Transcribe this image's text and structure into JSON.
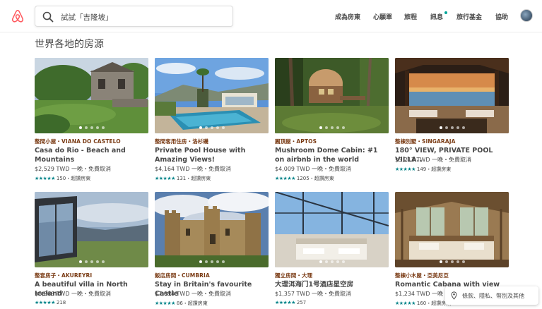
{
  "header": {
    "search_placeholder": "試試「吉隆坡」",
    "nav": [
      "成為房東",
      "心願單",
      "旅程",
      "訊息",
      "旅行基金",
      "協助"
    ]
  },
  "section_title": "世界各地的房源",
  "listings": [
    {
      "kind": "整間小屋・VIANA DO CASTELO",
      "title": "Casa do Rio - Beach and Mountains",
      "price": "$2,529 TWD 一晚・免費取消",
      "stars": "★★★★★",
      "reviews": "150・超讚房東"
    },
    {
      "kind": "整間客用住房・洛杉磯",
      "title": "Private Pool House with Amazing Views!",
      "price": "$4,164 TWD 一晚・免費取消",
      "stars": "★★★★★",
      "reviews": "131・超讚房東"
    },
    {
      "kind": "圓頂屋・APTOS",
      "title": "Mushroom Dome Cabin: #1 on airbnb in the world",
      "price": "$4,009 TWD 一晚・免費取消",
      "stars": "★★★★★",
      "reviews": "1205・超讚房東"
    },
    {
      "kind": "整棟別墅・SINGARAJA",
      "title": "180° VIEW, PRIVATE POOL VILLA..",
      "price": "$5,212 TWD 一晚・免費取消",
      "stars": "★★★★★",
      "reviews": "149・超讚房東"
    },
    {
      "kind": "整套房子・AKUREYRI",
      "title": "A beautiful villa in North Iceland",
      "price": "$8,266 TWD 一晚・免費取消",
      "stars": "★★★★★",
      "reviews": "218"
    },
    {
      "kind": "飯店房間・CUMBRIA",
      "title": "Stay in Britain's favourite Castle",
      "price": "$7,094 TWD 一晚・免費取消",
      "stars": "★★★★★",
      "reviews": "86・超讚房東"
    },
    {
      "kind": "獨立房間・大理",
      "title": "大理洱海门1号酒店星空房",
      "price": "$1,357 TWD 一晚・免費取消",
      "stars": "★★★★★",
      "reviews": "257"
    },
    {
      "kind": "整棟小木屋・亞美尼亞",
      "title": "Romantic Cabana with view",
      "price": "$1,234 TWD 一晚・免費取消",
      "stars": "★★★★★",
      "reviews": "160・超讚房東"
    }
  ],
  "footer_pill": "條款、隱私、幣別及其他",
  "colors": {
    "brand": "#FF5A5F",
    "teal": "#008489",
    "kind": "#7a3b14"
  },
  "icons": [
    "airbnb-logo",
    "search-icon",
    "location-pin-icon"
  ]
}
